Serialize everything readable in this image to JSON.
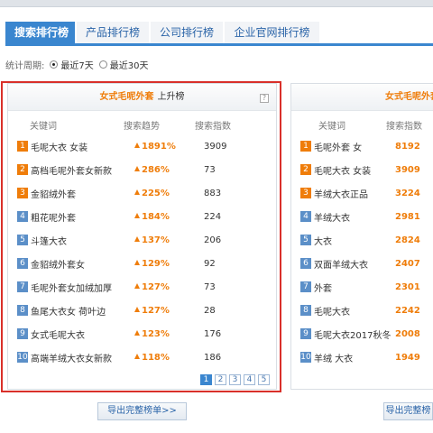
{
  "tabs": [
    "搜索排行榜",
    "产品排行榜",
    "公司排行榜",
    "企业官网排行榜"
  ],
  "period": {
    "label": "统计周期:",
    "options": [
      {
        "label": "最近7天",
        "checked": true
      },
      {
        "label": "最近30天",
        "checked": false
      }
    ]
  },
  "left_panel": {
    "title_keyword": "女式毛呢外套",
    "title_suffix": "上升榜",
    "help": "?",
    "headers": {
      "keyword": "关键词",
      "trend": "搜索趋势",
      "index": "搜索指数"
    },
    "rows": [
      {
        "rank": "1",
        "keyword": "毛呢大衣 女装",
        "trend": "1891%",
        "index": "3909"
      },
      {
        "rank": "2",
        "keyword": "高档毛呢外套女新款",
        "trend": "286%",
        "index": "73"
      },
      {
        "rank": "3",
        "keyword": "金貂绒外套",
        "trend": "225%",
        "index": "883"
      },
      {
        "rank": "4",
        "keyword": "粗花呢外套",
        "trend": "184%",
        "index": "224"
      },
      {
        "rank": "5",
        "keyword": "斗篷大衣",
        "trend": "137%",
        "index": "206"
      },
      {
        "rank": "6",
        "keyword": "金貂绒外套女",
        "trend": "129%",
        "index": "92"
      },
      {
        "rank": "7",
        "keyword": "毛呢外套女加绒加厚",
        "trend": "127%",
        "index": "73"
      },
      {
        "rank": "8",
        "keyword": "鱼尾大衣女 荷叶边",
        "trend": "127%",
        "index": "28"
      },
      {
        "rank": "9",
        "keyword": "女式毛呢大衣",
        "trend": "123%",
        "index": "176"
      },
      {
        "rank": "10",
        "keyword": "高端羊绒大衣女新款",
        "trend": "118%",
        "index": "186"
      }
    ],
    "pages": [
      "1",
      "2",
      "3",
      "4",
      "5"
    ],
    "export_label": "导出完整榜单>>"
  },
  "right_panel": {
    "title_keyword": "女式毛呢外套",
    "headers": {
      "keyword": "关键词",
      "index": "搜索指数"
    },
    "rows": [
      {
        "rank": "1",
        "keyword": "毛呢外套 女",
        "index": "8192"
      },
      {
        "rank": "2",
        "keyword": "毛呢大衣 女装",
        "index": "3909"
      },
      {
        "rank": "3",
        "keyword": "羊绒大衣正品",
        "index": "3224"
      },
      {
        "rank": "4",
        "keyword": "羊绒大衣",
        "index": "2981"
      },
      {
        "rank": "5",
        "keyword": "大衣",
        "index": "2824"
      },
      {
        "rank": "6",
        "keyword": "双面羊绒大衣",
        "index": "2407"
      },
      {
        "rank": "7",
        "keyword": "外套",
        "index": "2301"
      },
      {
        "rank": "8",
        "keyword": "毛呢大衣",
        "index": "2242"
      },
      {
        "rank": "9",
        "keyword": "毛呢大衣2017秋冬",
        "index": "2008"
      },
      {
        "rank": "10",
        "keyword": "羊绒 大衣",
        "index": "1949"
      }
    ],
    "export_label": "导出完整榜"
  },
  "colors": {
    "accent": "#3a86cf",
    "trend": "#ef7d0a",
    "highlight": "#d9302a"
  }
}
